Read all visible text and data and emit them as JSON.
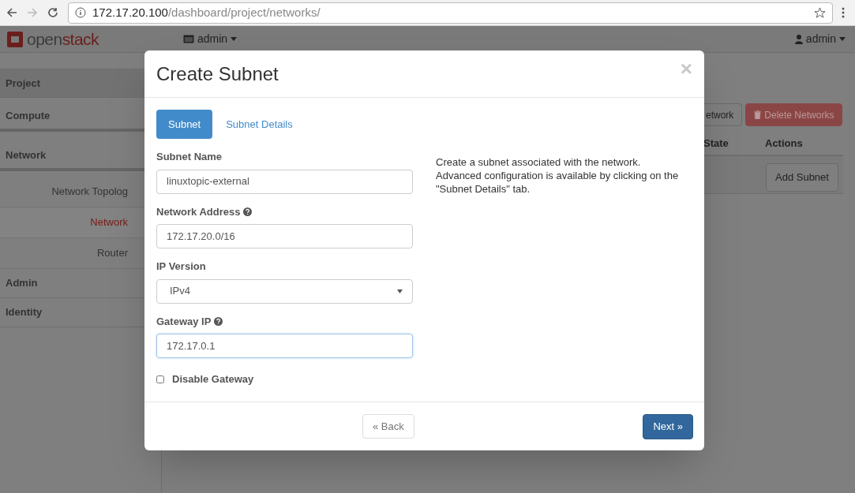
{
  "browser": {
    "url_host": "172.17.20.100",
    "url_path": "/dashboard/project/networks/"
  },
  "navbar": {
    "logo_parts": [
      "open",
      "stack"
    ],
    "project_selector": "admin",
    "user_menu": "admin"
  },
  "sidebar": {
    "items": [
      {
        "label": "Project",
        "selected": true
      },
      {
        "label": "Compute",
        "selected": false
      },
      {
        "label": "Network",
        "selected": false,
        "children": [
          {
            "label": "Network Topolog",
            "selected": false
          },
          {
            "label": "Network",
            "selected": true
          },
          {
            "label": "Router",
            "selected": false
          }
        ]
      },
      {
        "label": "Admin",
        "selected": false
      },
      {
        "label": "Identity",
        "selected": false
      }
    ]
  },
  "page": {
    "buttons": [
      {
        "label": "etwork",
        "kind": "default"
      },
      {
        "label": "Delete Networks",
        "kind": "danger"
      }
    ],
    "table": {
      "columns": [
        "State",
        "Actions"
      ],
      "row_action": "Add Subnet"
    }
  },
  "modal": {
    "title": "Create Subnet",
    "close": "×",
    "tabs": [
      {
        "label": "Subnet",
        "selected": true
      },
      {
        "label": "Subnet Details",
        "selected": false
      }
    ],
    "fields": [
      {
        "kind": "text",
        "label": "Subnet Name",
        "value": "linuxtopic-external",
        "focused": false
      },
      {
        "kind": "text",
        "label": "Network Address",
        "help_icon": true,
        "value": "172.17.20.0/16",
        "focused": false
      },
      {
        "kind": "select",
        "label": "IP Version",
        "value": "IPv4",
        "focused": false
      },
      {
        "kind": "text",
        "label": "Gateway IP",
        "help_icon": true,
        "value": "172.17.0.1",
        "focused": true
      },
      {
        "kind": "checkbox",
        "label": "Disable Gateway",
        "checked": false
      }
    ],
    "help_text": "Create a subnet associated with the network. Advanced configuration is available by clicking on the \"Subnet Details\" tab.",
    "back_button": "« Back",
    "next_button": "Next »"
  }
}
